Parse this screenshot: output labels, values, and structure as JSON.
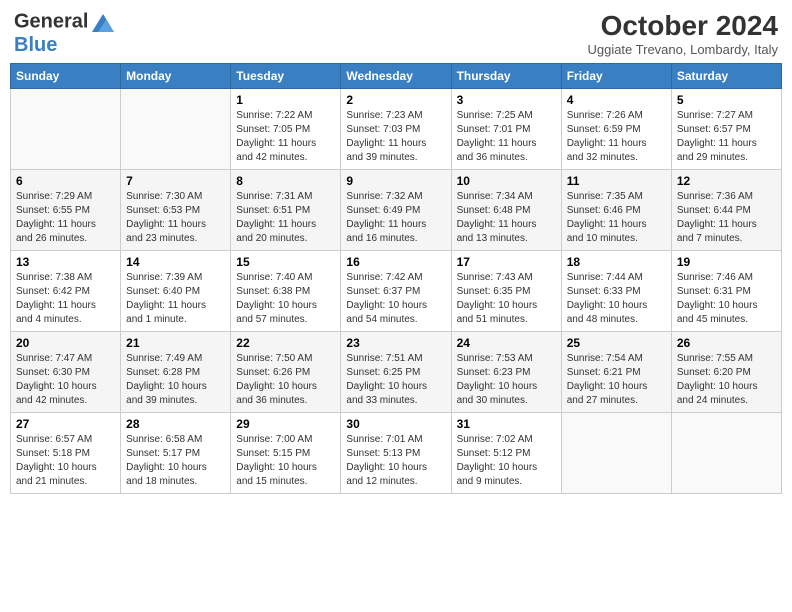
{
  "header": {
    "logo_line1": "General",
    "logo_line2": "Blue",
    "month": "October 2024",
    "location": "Uggiate Trevano, Lombardy, Italy"
  },
  "days_of_week": [
    "Sunday",
    "Monday",
    "Tuesday",
    "Wednesday",
    "Thursday",
    "Friday",
    "Saturday"
  ],
  "weeks": [
    [
      {
        "day": "",
        "info": ""
      },
      {
        "day": "",
        "info": ""
      },
      {
        "day": "1",
        "info": "Sunrise: 7:22 AM\nSunset: 7:05 PM\nDaylight: 11 hours and 42 minutes."
      },
      {
        "day": "2",
        "info": "Sunrise: 7:23 AM\nSunset: 7:03 PM\nDaylight: 11 hours and 39 minutes."
      },
      {
        "day": "3",
        "info": "Sunrise: 7:25 AM\nSunset: 7:01 PM\nDaylight: 11 hours and 36 minutes."
      },
      {
        "day": "4",
        "info": "Sunrise: 7:26 AM\nSunset: 6:59 PM\nDaylight: 11 hours and 32 minutes."
      },
      {
        "day": "5",
        "info": "Sunrise: 7:27 AM\nSunset: 6:57 PM\nDaylight: 11 hours and 29 minutes."
      }
    ],
    [
      {
        "day": "6",
        "info": "Sunrise: 7:29 AM\nSunset: 6:55 PM\nDaylight: 11 hours and 26 minutes."
      },
      {
        "day": "7",
        "info": "Sunrise: 7:30 AM\nSunset: 6:53 PM\nDaylight: 11 hours and 23 minutes."
      },
      {
        "day": "8",
        "info": "Sunrise: 7:31 AM\nSunset: 6:51 PM\nDaylight: 11 hours and 20 minutes."
      },
      {
        "day": "9",
        "info": "Sunrise: 7:32 AM\nSunset: 6:49 PM\nDaylight: 11 hours and 16 minutes."
      },
      {
        "day": "10",
        "info": "Sunrise: 7:34 AM\nSunset: 6:48 PM\nDaylight: 11 hours and 13 minutes."
      },
      {
        "day": "11",
        "info": "Sunrise: 7:35 AM\nSunset: 6:46 PM\nDaylight: 11 hours and 10 minutes."
      },
      {
        "day": "12",
        "info": "Sunrise: 7:36 AM\nSunset: 6:44 PM\nDaylight: 11 hours and 7 minutes."
      }
    ],
    [
      {
        "day": "13",
        "info": "Sunrise: 7:38 AM\nSunset: 6:42 PM\nDaylight: 11 hours and 4 minutes."
      },
      {
        "day": "14",
        "info": "Sunrise: 7:39 AM\nSunset: 6:40 PM\nDaylight: 11 hours and 1 minute."
      },
      {
        "day": "15",
        "info": "Sunrise: 7:40 AM\nSunset: 6:38 PM\nDaylight: 10 hours and 57 minutes."
      },
      {
        "day": "16",
        "info": "Sunrise: 7:42 AM\nSunset: 6:37 PM\nDaylight: 10 hours and 54 minutes."
      },
      {
        "day": "17",
        "info": "Sunrise: 7:43 AM\nSunset: 6:35 PM\nDaylight: 10 hours and 51 minutes."
      },
      {
        "day": "18",
        "info": "Sunrise: 7:44 AM\nSunset: 6:33 PM\nDaylight: 10 hours and 48 minutes."
      },
      {
        "day": "19",
        "info": "Sunrise: 7:46 AM\nSunset: 6:31 PM\nDaylight: 10 hours and 45 minutes."
      }
    ],
    [
      {
        "day": "20",
        "info": "Sunrise: 7:47 AM\nSunset: 6:30 PM\nDaylight: 10 hours and 42 minutes."
      },
      {
        "day": "21",
        "info": "Sunrise: 7:49 AM\nSunset: 6:28 PM\nDaylight: 10 hours and 39 minutes."
      },
      {
        "day": "22",
        "info": "Sunrise: 7:50 AM\nSunset: 6:26 PM\nDaylight: 10 hours and 36 minutes."
      },
      {
        "day": "23",
        "info": "Sunrise: 7:51 AM\nSunset: 6:25 PM\nDaylight: 10 hours and 33 minutes."
      },
      {
        "day": "24",
        "info": "Sunrise: 7:53 AM\nSunset: 6:23 PM\nDaylight: 10 hours and 30 minutes."
      },
      {
        "day": "25",
        "info": "Sunrise: 7:54 AM\nSunset: 6:21 PM\nDaylight: 10 hours and 27 minutes."
      },
      {
        "day": "26",
        "info": "Sunrise: 7:55 AM\nSunset: 6:20 PM\nDaylight: 10 hours and 24 minutes."
      }
    ],
    [
      {
        "day": "27",
        "info": "Sunrise: 6:57 AM\nSunset: 5:18 PM\nDaylight: 10 hours and 21 minutes."
      },
      {
        "day": "28",
        "info": "Sunrise: 6:58 AM\nSunset: 5:17 PM\nDaylight: 10 hours and 18 minutes."
      },
      {
        "day": "29",
        "info": "Sunrise: 7:00 AM\nSunset: 5:15 PM\nDaylight: 10 hours and 15 minutes."
      },
      {
        "day": "30",
        "info": "Sunrise: 7:01 AM\nSunset: 5:13 PM\nDaylight: 10 hours and 12 minutes."
      },
      {
        "day": "31",
        "info": "Sunrise: 7:02 AM\nSunset: 5:12 PM\nDaylight: 10 hours and 9 minutes."
      },
      {
        "day": "",
        "info": ""
      },
      {
        "day": "",
        "info": ""
      }
    ]
  ]
}
